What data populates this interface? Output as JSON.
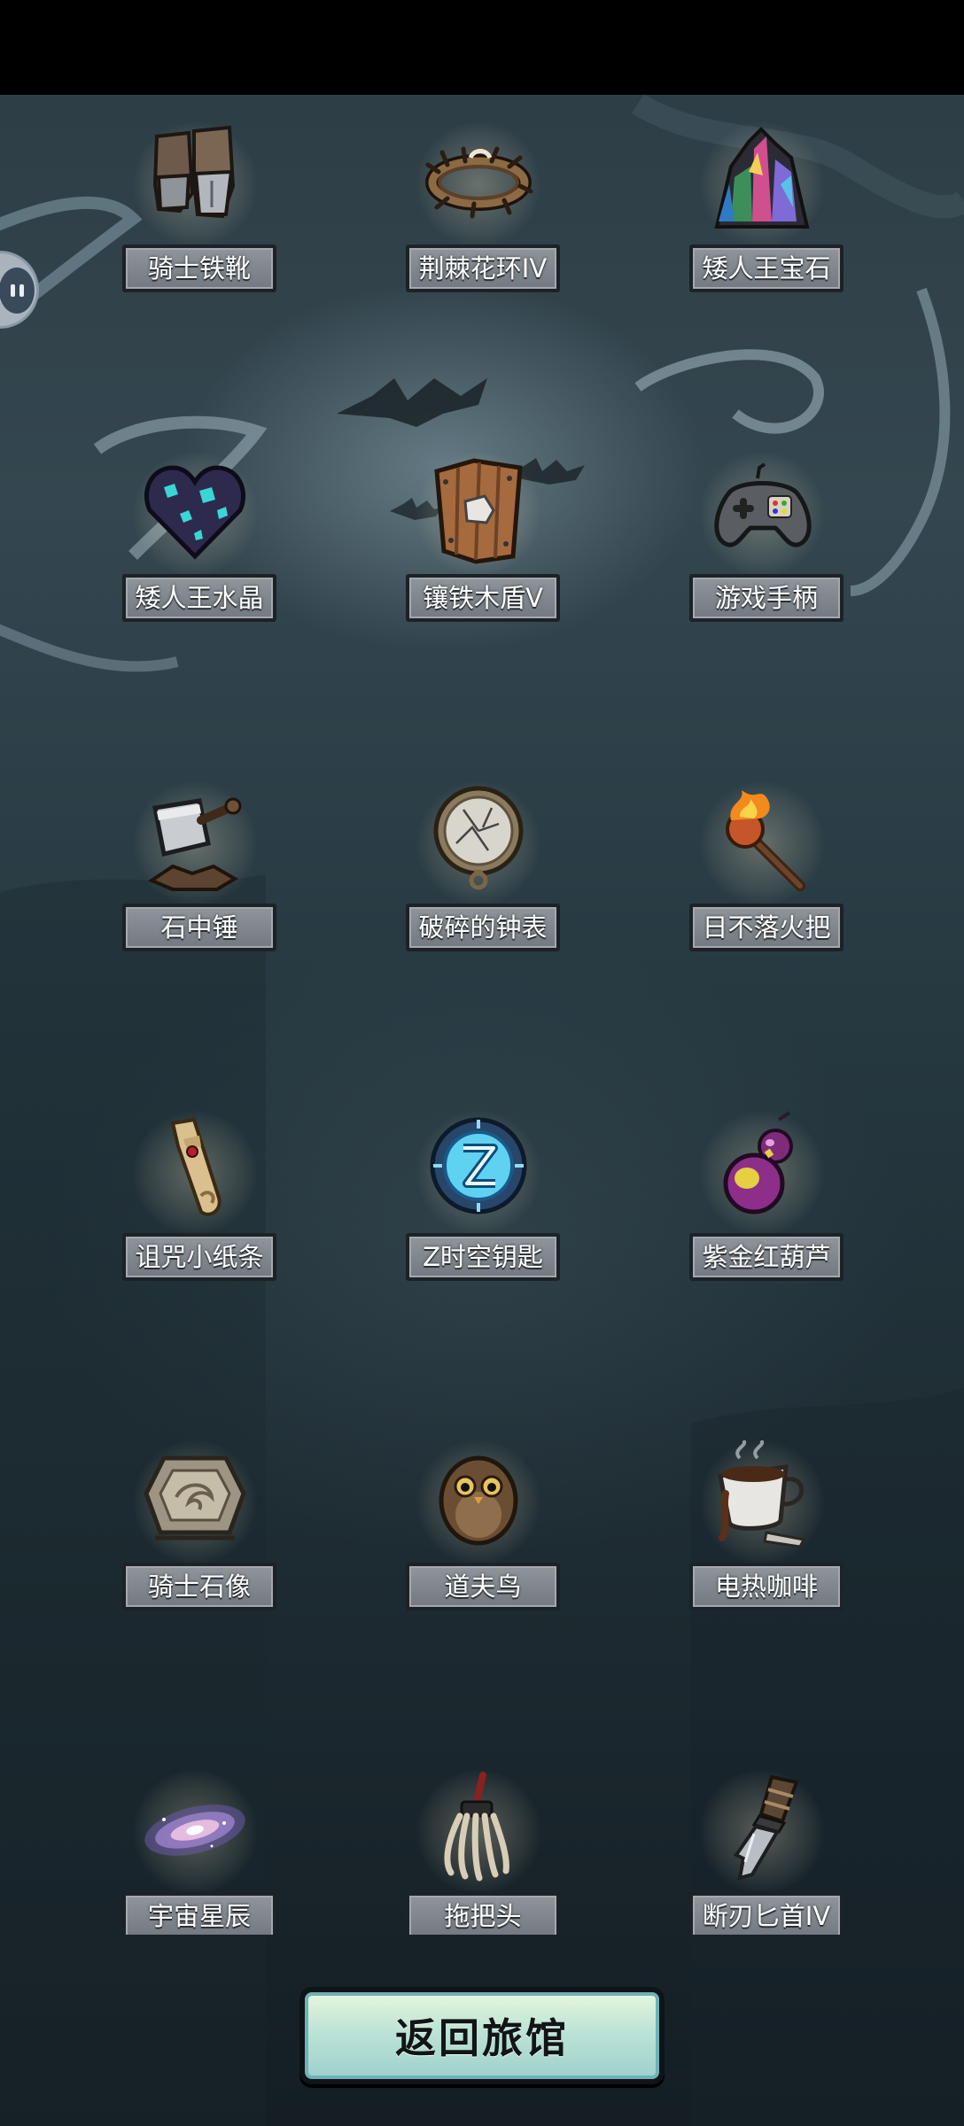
{
  "screen": {
    "title": "",
    "pause_icon": "pause-icon"
  },
  "items": [
    {
      "label": "骑士铁靴",
      "icon": "iron-boots-icon"
    },
    {
      "label": "荆棘花环IV",
      "icon": "thorn-wreath-icon"
    },
    {
      "label": "矮人王宝石",
      "icon": "dwarf-gem-icon"
    },
    {
      "label": "矮人王水晶",
      "icon": "dwarf-crystal-icon"
    },
    {
      "label": "镶铁木盾V",
      "icon": "wooden-shield-icon"
    },
    {
      "label": "游戏手柄",
      "icon": "gamepad-icon"
    },
    {
      "label": "石中锤",
      "icon": "hammer-in-stone-icon"
    },
    {
      "label": "破碎的钟表",
      "icon": "broken-pocket-watch-icon"
    },
    {
      "label": "日不落火把",
      "icon": "torch-icon"
    },
    {
      "label": "诅咒小纸条",
      "icon": "cursed-scroll-icon"
    },
    {
      "label": "Z时空钥匙",
      "icon": "spacetime-key-icon"
    },
    {
      "label": "紫金红葫芦",
      "icon": "gourd-icon"
    },
    {
      "label": "骑士石像",
      "icon": "knight-statue-icon"
    },
    {
      "label": "道夫鸟",
      "icon": "owl-bird-icon"
    },
    {
      "label": "电热咖啡",
      "icon": "coffee-cup-icon"
    },
    {
      "label": "宇宙星辰",
      "icon": "galaxy-icon"
    },
    {
      "label": "拖把头",
      "icon": "mop-head-icon"
    },
    {
      "label": "断刃匕首IV",
      "icon": "broken-dagger-icon"
    }
  ],
  "footer": {
    "return_label": "返回旅馆"
  }
}
